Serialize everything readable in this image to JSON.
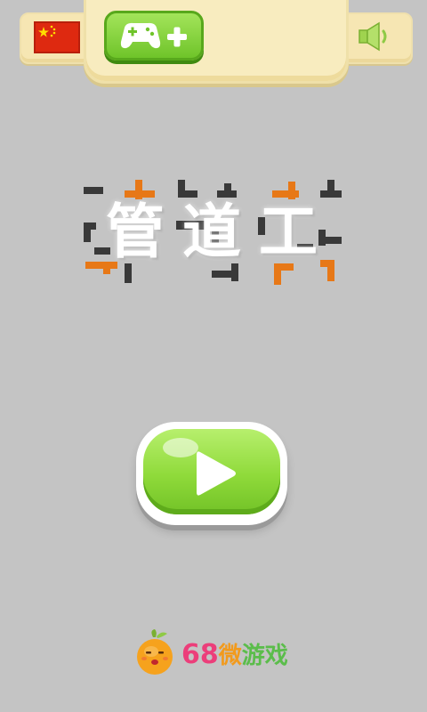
{
  "header": {
    "language_flag_icon": "china-flag-icon",
    "game_center_icon": "gamepad-plus-icon",
    "sound_icon": "speaker-on-icon"
  },
  "title": {
    "text": "管道工"
  },
  "play": {
    "icon": "play-triangle-icon"
  },
  "footer": {
    "brand_number": "68",
    "brand_word1": "微",
    "brand_word2": "游戏"
  },
  "colors": {
    "background": "#c4c4c4",
    "panel": "#f6e6b3",
    "green_button": "#8fda3a",
    "pipe_orange": "#e77817",
    "pipe_dark": "#2b2b2b",
    "flag_red": "#de2910",
    "flag_star": "#ffde00"
  }
}
